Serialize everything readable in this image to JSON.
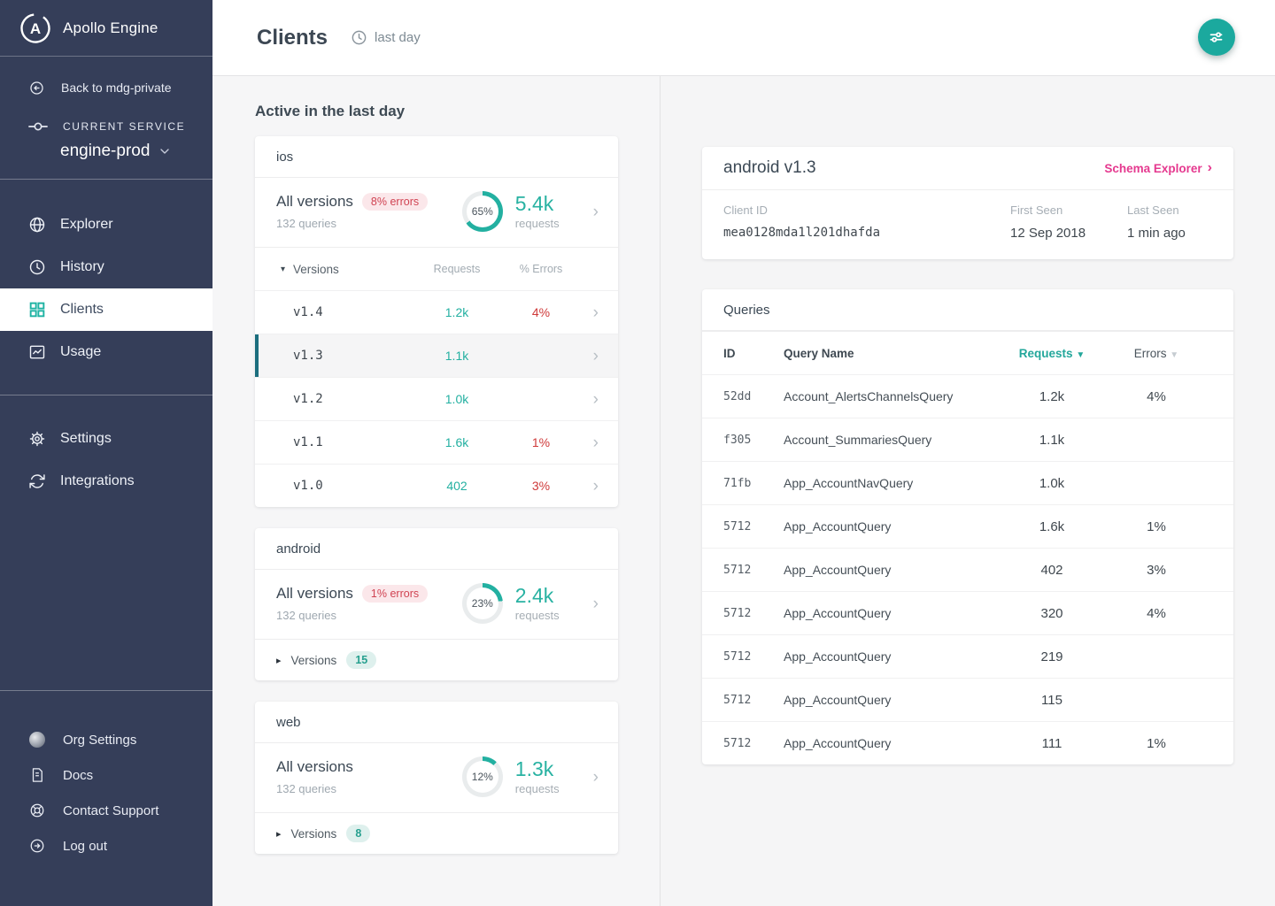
{
  "colors": {
    "teal": "#23b0a1",
    "teal_dark": "#1b6e7e",
    "pink": "#e5398f",
    "red": "#cf3a3a",
    "sidebar_bg": "#353e59"
  },
  "sidebar": {
    "app_name": "Apollo Engine",
    "back_link": "Back to mdg-private",
    "current_service_label": "CURRENT SERVICE",
    "current_service": "engine-prod",
    "nav": [
      {
        "label": "Explorer",
        "icon": "globe-icon",
        "active": false
      },
      {
        "label": "History",
        "icon": "clock-icon",
        "active": false
      },
      {
        "label": "Clients",
        "icon": "grid-icon",
        "active": true
      },
      {
        "label": "Usage",
        "icon": "chart-icon",
        "active": false
      }
    ],
    "nav_secondary": [
      {
        "label": "Settings",
        "icon": "gear-icon"
      },
      {
        "label": "Integrations",
        "icon": "sync-icon"
      }
    ],
    "nav_footer": [
      {
        "label": "Org Settings",
        "icon": "avatar"
      },
      {
        "label": "Docs",
        "icon": "document-icon"
      },
      {
        "label": "Contact Support",
        "icon": "life-ring-icon"
      },
      {
        "label": "Log out",
        "icon": "logout-icon"
      }
    ]
  },
  "header": {
    "title": "Clients",
    "time_range": "last day",
    "fab_icon": "sliders-icon"
  },
  "main": {
    "section_title": "Active in the last day",
    "clients": [
      {
        "name": "ios",
        "all_versions_label": "All versions",
        "error_badge": "8% errors",
        "queries": "132 queries",
        "ring_percent": 65,
        "ring_label": "65%",
        "requests_value": "5.4k",
        "requests_label": "requests",
        "versions_label": "Versions",
        "requests_col": "Requests",
        "errors_col": "% Errors",
        "versions": [
          {
            "name": "v1.4",
            "requests": "1.2k",
            "errors": "4%",
            "selected": false
          },
          {
            "name": "v1.3",
            "requests": "1.1k",
            "errors": "",
            "selected": true
          },
          {
            "name": "v1.2",
            "requests": "1.0k",
            "errors": "",
            "selected": false
          },
          {
            "name": "v1.1",
            "requests": "1.6k",
            "errors": "1%",
            "selected": false
          },
          {
            "name": "v1.0",
            "requests": "402",
            "errors": "3%",
            "selected": false
          }
        ]
      },
      {
        "name": "android",
        "all_versions_label": "All versions",
        "error_badge": "1% errors",
        "queries": "132 queries",
        "ring_percent": 23,
        "ring_label": "23%",
        "requests_value": "2.4k",
        "requests_label": "requests",
        "versions_label": "Versions",
        "versions_count": "15"
      },
      {
        "name": "web",
        "all_versions_label": "All versions",
        "queries": "132 queries",
        "ring_percent": 12,
        "ring_label": "12%",
        "requests_value": "1.3k",
        "requests_label": "requests",
        "versions_label": "Versions",
        "versions_count": "8"
      }
    ]
  },
  "detail": {
    "title": "android v1.3",
    "schema_explorer_label": "Schema Explorer",
    "client_id_label": "Client ID",
    "client_id": "mea0128mda1l201dhafda",
    "first_seen_label": "First Seen",
    "first_seen": "12 Sep 2018",
    "last_seen_label": "Last Seen",
    "last_seen": "1 min ago",
    "queries_title": "Queries",
    "columns": {
      "id": "ID",
      "name": "Query Name",
      "requests": "Requests",
      "errors": "Errors"
    },
    "rows": [
      {
        "id": "52dd",
        "name": "Account_AlertsChannelsQuery",
        "requests": "1.2k",
        "errors": "4%"
      },
      {
        "id": "f305",
        "name": "Account_SummariesQuery",
        "requests": "1.1k",
        "errors": ""
      },
      {
        "id": "71fb",
        "name": "App_AccountNavQuery",
        "requests": "1.0k",
        "errors": ""
      },
      {
        "id": "5712",
        "name": "App_AccountQuery",
        "requests": "1.6k",
        "errors": "1%"
      },
      {
        "id": "5712",
        "name": "App_AccountQuery",
        "requests": "402",
        "errors": "3%"
      },
      {
        "id": "5712",
        "name": "App_AccountQuery",
        "requests": "320",
        "errors": "4%"
      },
      {
        "id": "5712",
        "name": "App_AccountQuery",
        "requests": "219",
        "errors": ""
      },
      {
        "id": "5712",
        "name": "App_AccountQuery",
        "requests": "115",
        "errors": ""
      },
      {
        "id": "5712",
        "name": "App_AccountQuery",
        "requests": "111",
        "errors": "1%"
      }
    ]
  }
}
